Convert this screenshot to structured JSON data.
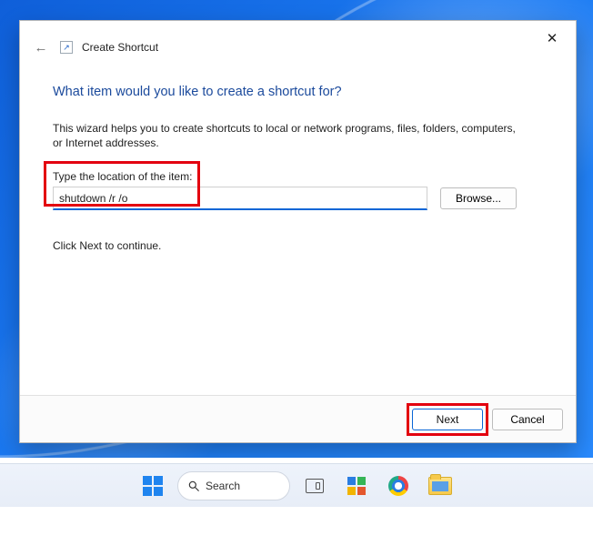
{
  "window": {
    "title": "Create Shortcut",
    "close_symbol": "✕",
    "back_symbol": "←",
    "shortcut_glyph": "↗"
  },
  "wizard": {
    "heading": "What item would you like to create a shortcut for?",
    "description": "This wizard helps you to create shortcuts to local or network programs, files, folders, computers, or Internet addresses.",
    "location_label": "Type the location of the item:",
    "location_value": "shutdown /r /o",
    "browse_label": "Browse...",
    "continue_hint": "Click Next to continue."
  },
  "footer": {
    "next_label": "Next",
    "cancel_label": "Cancel"
  },
  "taskbar": {
    "search_placeholder": "Search"
  },
  "annotations": {
    "highlight_color": "#e3000f"
  }
}
